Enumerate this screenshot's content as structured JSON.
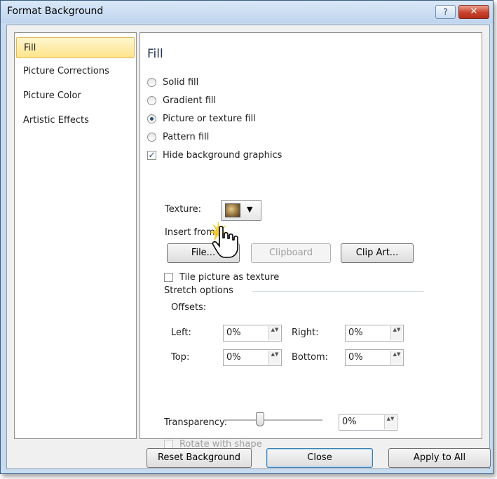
{
  "window": {
    "title": "Format Background",
    "help_label": "?",
    "close_label": "✕"
  },
  "sidebar": {
    "items": [
      {
        "label": "Fill",
        "selected": true
      },
      {
        "label": "Picture Corrections",
        "selected": false
      },
      {
        "label": "Picture Color",
        "selected": false
      },
      {
        "label": "Artistic Effects",
        "selected": false
      }
    ]
  },
  "fill": {
    "title": "Fill",
    "options": [
      {
        "label": "Solid fill",
        "checked": false
      },
      {
        "label": "Gradient fill",
        "checked": false
      },
      {
        "label": "Picture or texture fill",
        "checked": true
      },
      {
        "label": "Pattern fill",
        "checked": false
      }
    ],
    "hide_background_graphics": {
      "label": "Hide background graphics",
      "checked": true,
      "mark": "✓"
    },
    "texture_label": "Texture:",
    "texture_arrow": "▼",
    "insert_from_label": "Insert from:",
    "buttons": {
      "file": "File...",
      "clipboard": "Clipboard",
      "clip_art": "Clip Art..."
    },
    "tile_label": "Tile picture as texture",
    "stretch_options_label": "Stretch options",
    "offsets_label": "Offsets:",
    "offsets": {
      "left_label": "Left:",
      "left_value": "0%",
      "right_label": "Right:",
      "right_value": "0%",
      "top_label": "Top:",
      "top_value": "0%",
      "bottom_label": "Bottom:",
      "bottom_value": "0%"
    },
    "spin_arrows": "▲▼",
    "transparency_label": "Transparency:",
    "transparency_value": "0%",
    "transparency_level": 0,
    "rotate_label": "Rotate with shape"
  },
  "footer": {
    "reset": "Reset Background",
    "close": "Close",
    "apply_all": "Apply to All"
  },
  "colors": {
    "selection": "#ffe48c",
    "accent": "#3c7fb1",
    "close": "#c9412b"
  }
}
